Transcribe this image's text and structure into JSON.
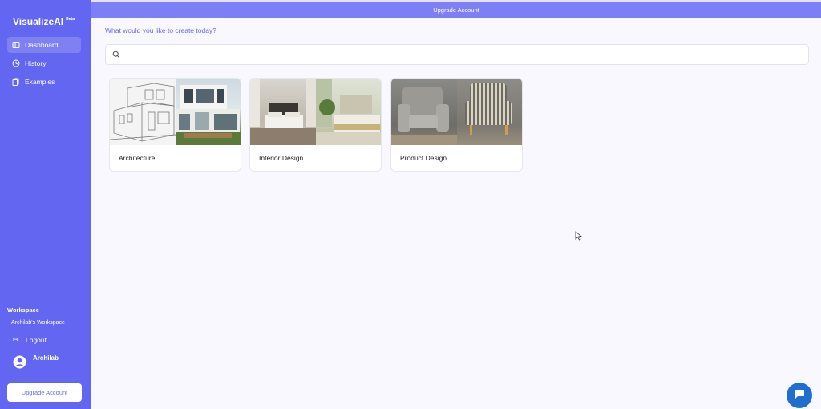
{
  "brand": {
    "name": "VisualizeAI",
    "badge": "Beta"
  },
  "sidebar": {
    "items": [
      {
        "label": "Dashboard",
        "icon": "dashboard-icon",
        "active": true
      },
      {
        "label": "History",
        "icon": "history-icon",
        "active": false
      },
      {
        "label": "Examples",
        "icon": "examples-icon",
        "active": false
      }
    ],
    "workspace_title": "Workspace",
    "workspace_name": "Archilab's Workspace",
    "logout_label": "Logout",
    "user_name": "Archilab",
    "upgrade_label": "Upgrade Account"
  },
  "banner": {
    "label": "Upgrade Account"
  },
  "main": {
    "prompt": "What would you like to create today?",
    "search_placeholder": "",
    "cards": [
      {
        "label": "Architecture"
      },
      {
        "label": "Interior Design"
      },
      {
        "label": "Product Design"
      }
    ]
  },
  "colors": {
    "accent": "#6366f1",
    "banner": "#7d80f4",
    "chat": "#1f6fd1"
  }
}
